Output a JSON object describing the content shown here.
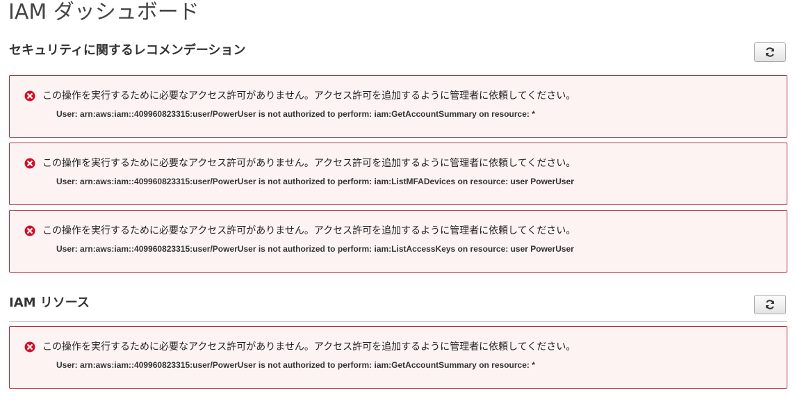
{
  "page": {
    "title": "IAM ダッシュボード"
  },
  "sections": [
    {
      "title": "セキュリティに関するレコメンデーション",
      "refresh_icon": "refresh-icon",
      "alerts": [
        {
          "icon": "error-icon",
          "message": "この操作を実行するために必要なアクセス許可がありません。アクセス許可を追加するように管理者に依頼してください。",
          "detail": "User: arn:aws:iam::409960823315:user/PowerUser is not authorized to perform: iam:GetAccountSummary on resource: *"
        },
        {
          "icon": "error-icon",
          "message": "この操作を実行するために必要なアクセス許可がありません。アクセス許可を追加するように管理者に依頼してください。",
          "detail": "User: arn:aws:iam::409960823315:user/PowerUser is not authorized to perform: iam:ListMFADevices on resource: user PowerUser"
        },
        {
          "icon": "error-icon",
          "message": "この操作を実行するために必要なアクセス許可がありません。アクセス許可を追加するように管理者に依頼してください。",
          "detail": "User: arn:aws:iam::409960823315:user/PowerUser is not authorized to perform: iam:ListAccessKeys on resource: user PowerUser"
        }
      ]
    },
    {
      "title": "IAM リソース",
      "refresh_icon": "refresh-icon",
      "alerts": [
        {
          "icon": "error-icon",
          "message": "この操作を実行するために必要なアクセス許可がありません。アクセス許可を追加するように管理者に依頼してください。",
          "detail": "User: arn:aws:iam::409960823315:user/PowerUser is not authorized to perform: iam:GetAccountSummary on resource: *"
        }
      ]
    }
  ],
  "colors": {
    "alert_border": "#b0303f",
    "alert_background": "#fdf3f3",
    "error_icon": "#d0102a"
  }
}
